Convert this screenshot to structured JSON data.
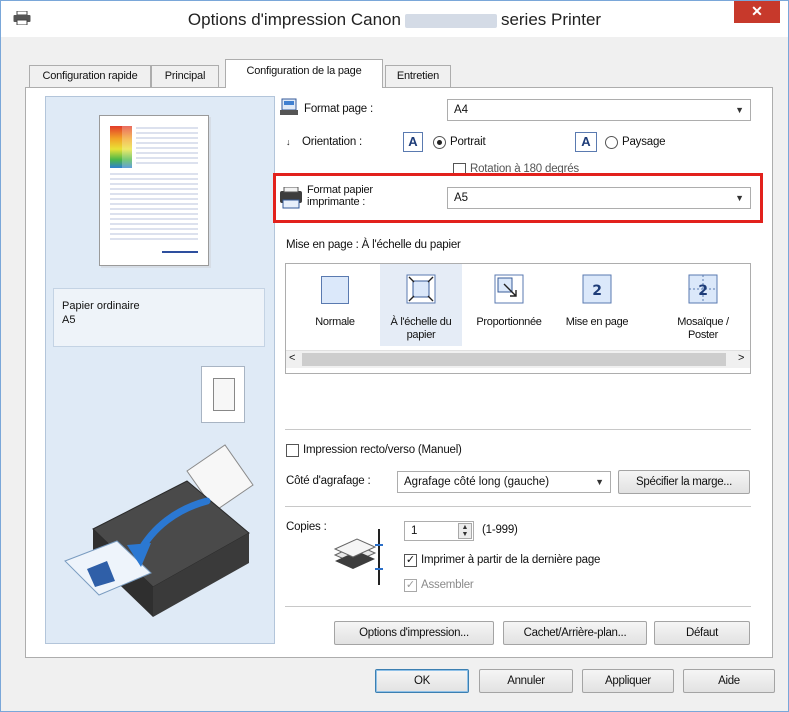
{
  "window": {
    "title_prefix": "Options d'impression Canon",
    "title_suffix": "series Printer",
    "close_label": "✕"
  },
  "tabs": [
    {
      "label": "Configuration rapide"
    },
    {
      "label": "Principal"
    },
    {
      "label": "Configuration de la page"
    },
    {
      "label": "Entretien"
    }
  ],
  "preview": {
    "media_type": "Papier ordinaire",
    "paper_size": "A5"
  },
  "page_setup": {
    "format_page_label": "Format page :",
    "format_page_value": "A4",
    "orientation_label": "Orientation :",
    "portrait_label": "Portrait",
    "paysage_label": "Paysage",
    "orientation_selected": "Portrait",
    "rotation_label": "Rotation à 180 degrés",
    "format_papier_label_line1": "Format papier",
    "format_papier_label_line2": "imprimante :",
    "format_papier_value": "A5",
    "mise_en_page_label": "Mise en page : À l'échelle du papier",
    "layouts": [
      {
        "line1": "Normale",
        "line2": ""
      },
      {
        "line1": "À l'échelle du",
        "line2": "papier"
      },
      {
        "line1": "Proportionnée",
        "line2": ""
      },
      {
        "line1": "Mise en page",
        "line2": ""
      },
      {
        "line1": "Mosaïque /",
        "line2": "Poster"
      }
    ],
    "selected_layout": "À l'échelle du papier"
  },
  "duplex": {
    "label": "Impression recto/verso (Manuel)",
    "checked": false,
    "stapling_label": "Côté d'agrafage :",
    "stapling_value": "Agrafage côté long (gauche)",
    "margin_button": "Spécifier la marge..."
  },
  "copies": {
    "label": "Copies :",
    "value": "1",
    "range": "(1-999)",
    "print_last_first_label": "Imprimer à partir de la dernière page",
    "print_last_first_checked": true,
    "collate_label": "Assembler",
    "collate_checked": true
  },
  "bottom_buttons": {
    "print_options": "Options d'impression...",
    "stamp_background": "Cachet/Arrière-plan...",
    "default": "Défaut"
  },
  "dialog_buttons": {
    "ok": "OK",
    "cancel": "Annuler",
    "apply": "Appliquer",
    "help": "Aide"
  },
  "colors": {
    "accent_red": "#e2211c",
    "preview_bg": "#dfeaf6",
    "close_button": "#c7392b"
  }
}
